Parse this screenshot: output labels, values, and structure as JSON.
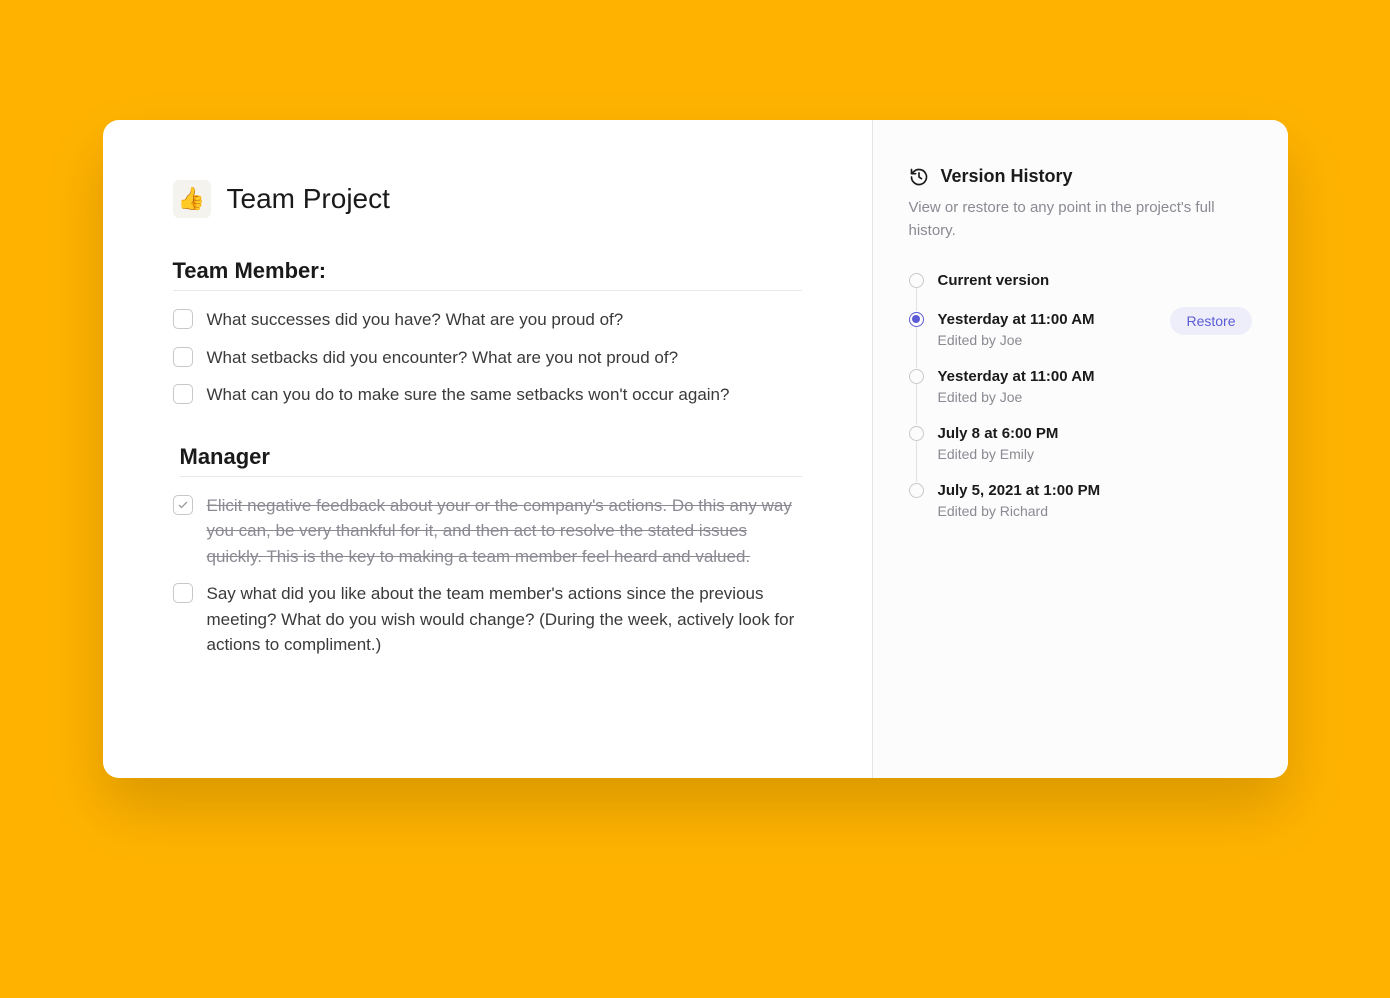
{
  "page": {
    "icon": "👍",
    "title": "Team Project"
  },
  "sections": [
    {
      "heading": "Team Member:",
      "indent": false,
      "tasks": [
        {
          "text": "What successes did you have? What are you proud of?",
          "done": false
        },
        {
          "text": "What setbacks did you encounter? What are you not proud of?",
          "done": false
        },
        {
          "text": "What can you do to make sure the same setbacks won't occur again?",
          "done": false
        }
      ]
    },
    {
      "heading": "Manager",
      "indent": true,
      "tasks": [
        {
          "text": "Elicit negative feedback about your or the company's actions. Do this any way you can, be very thankful for it, and then act to resolve the stated issues quickly. This is the key to making a team member feel heard and valued.",
          "done": true
        },
        {
          "text": "Say what did you like about the team member's actions since the previous meeting? What do you wish would change? (During the week, actively look for actions to compliment.)",
          "done": false
        }
      ]
    }
  ],
  "history": {
    "title": "Version History",
    "subtitle": "View or restore to any point in the project's full history.",
    "restore_label": "Restore",
    "versions": [
      {
        "label": "Current version",
        "meta": "",
        "selected": false,
        "restorable": false
      },
      {
        "label": "Yesterday at 11:00 AM",
        "meta": "Edited by Joe",
        "selected": true,
        "restorable": true
      },
      {
        "label": "Yesterday at 11:00 AM",
        "meta": "Edited by Joe",
        "selected": false,
        "restorable": false
      },
      {
        "label": "July 8 at 6:00 PM",
        "meta": "Edited by Emily",
        "selected": false,
        "restorable": false
      },
      {
        "label": "July 5, 2021 at 1:00 PM",
        "meta": "Edited by Richard",
        "selected": false,
        "restorable": false
      }
    ]
  }
}
